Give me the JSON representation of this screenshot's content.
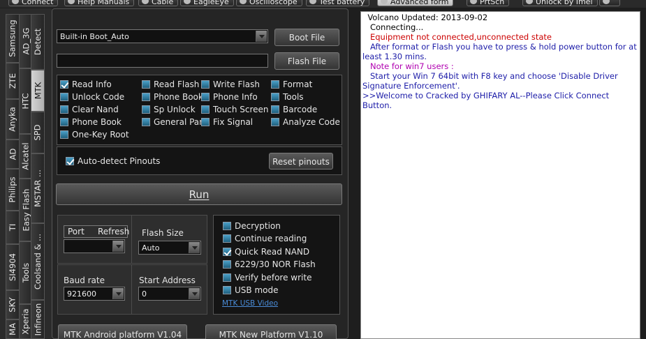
{
  "toolbar": {
    "buttons": [
      "Connect",
      "Help Manuals",
      "Cable",
      "EagleEye",
      "Oscilloscope",
      "Test battery",
      "Advanced form",
      "PrtScn",
      "Unlock by Imei"
    ]
  },
  "vtabs": {
    "col1": [
      "Samsung",
      "ZTE",
      "Anyka",
      "AD",
      "Philips",
      "TI",
      "SI4904",
      "SKY",
      "MA"
    ],
    "col2": [
      "AD_3G",
      "HTC",
      "Alcatel",
      "Easy Flash",
      "Tools",
      "Xperia"
    ],
    "col3": [
      "Detect",
      "MTK",
      "SPD",
      "MSTAR ...",
      "Coolsand & ...",
      "Infineon"
    ]
  },
  "main": {
    "boot_select": "Built-in Boot_Auto",
    "flash_file_value": "",
    "boot_file_btn": "Boot File",
    "flash_file_btn": "Flash File",
    "functions": [
      {
        "label": "Read Info",
        "checked": true
      },
      {
        "label": "Read Flash",
        "checked": false
      },
      {
        "label": "Write Flash",
        "checked": false
      },
      {
        "label": "Format",
        "checked": false
      },
      {
        "label": "Unlock Code",
        "checked": false
      },
      {
        "label": "Phone Book",
        "checked": false
      },
      {
        "label": "Phone Info",
        "checked": false
      },
      {
        "label": "Tools",
        "checked": false
      },
      {
        "label": "Clear Nand",
        "checked": false
      },
      {
        "label": "Sp Unlock",
        "checked": false
      },
      {
        "label": "Touch Screen",
        "checked": false
      },
      {
        "label": "Barcode",
        "checked": false
      },
      {
        "label": "Phone Book",
        "checked": false
      },
      {
        "label": "General Para.",
        "checked": false
      },
      {
        "label": "Fix Signal",
        "checked": false
      },
      {
        "label": "Analyze Code",
        "checked": false
      },
      {
        "label": "One-Key Root",
        "checked": false
      }
    ],
    "autodetect_label": "Auto-detect Pinouts",
    "reset_pinouts": "Reset pinouts",
    "run": "Run",
    "port_label": "Port",
    "refresh_label": "Refresh",
    "port_value": "",
    "flash_size_label": "Flash Size",
    "flash_size_value": "Auto",
    "baud_label": "Baud rate",
    "baud_value": "921600",
    "start_addr_label": "Start Address",
    "start_addr_value": "0",
    "options": [
      {
        "label": "Decryption",
        "checked": false
      },
      {
        "label": "Continue reading",
        "checked": false
      },
      {
        "label": "Quick Read NAND",
        "checked": true
      },
      {
        "label": "6229/30 NOR Flash",
        "checked": false
      },
      {
        "label": "Verify before write",
        "checked": false
      },
      {
        "label": "USB mode",
        "checked": false
      }
    ],
    "usb_video_link": "MTK USB Video",
    "platform_v104": "MTK Android platform V1.04",
    "platform_v110": "MTK New Platform V1.10"
  },
  "log": [
    {
      "text": "  Volcano Updated: 2013-09-02",
      "color": "#000000"
    },
    {
      "text": "   Connecting...",
      "color": "#000000"
    },
    {
      "text": "   Equipment not connected,unconnected state",
      "color": "#cc0000"
    },
    {
      "text": "   After format or Flash you have to press & hold power button for at least 1.30 mins.",
      "color": "#1c1ca8"
    },
    {
      "text": "   Note for win7 users :",
      "color": "#b000b0"
    },
    {
      "text": "   Start your Win 7 64bit with F8 key and choose 'Disable Driver Signature Enforcement'.",
      "color": "#1c1ca8"
    },
    {
      "text": ">>Welcome to Cracked by GHIFARY AL--Please Click Connect Button.",
      "color": "#1c1ca8"
    }
  ]
}
